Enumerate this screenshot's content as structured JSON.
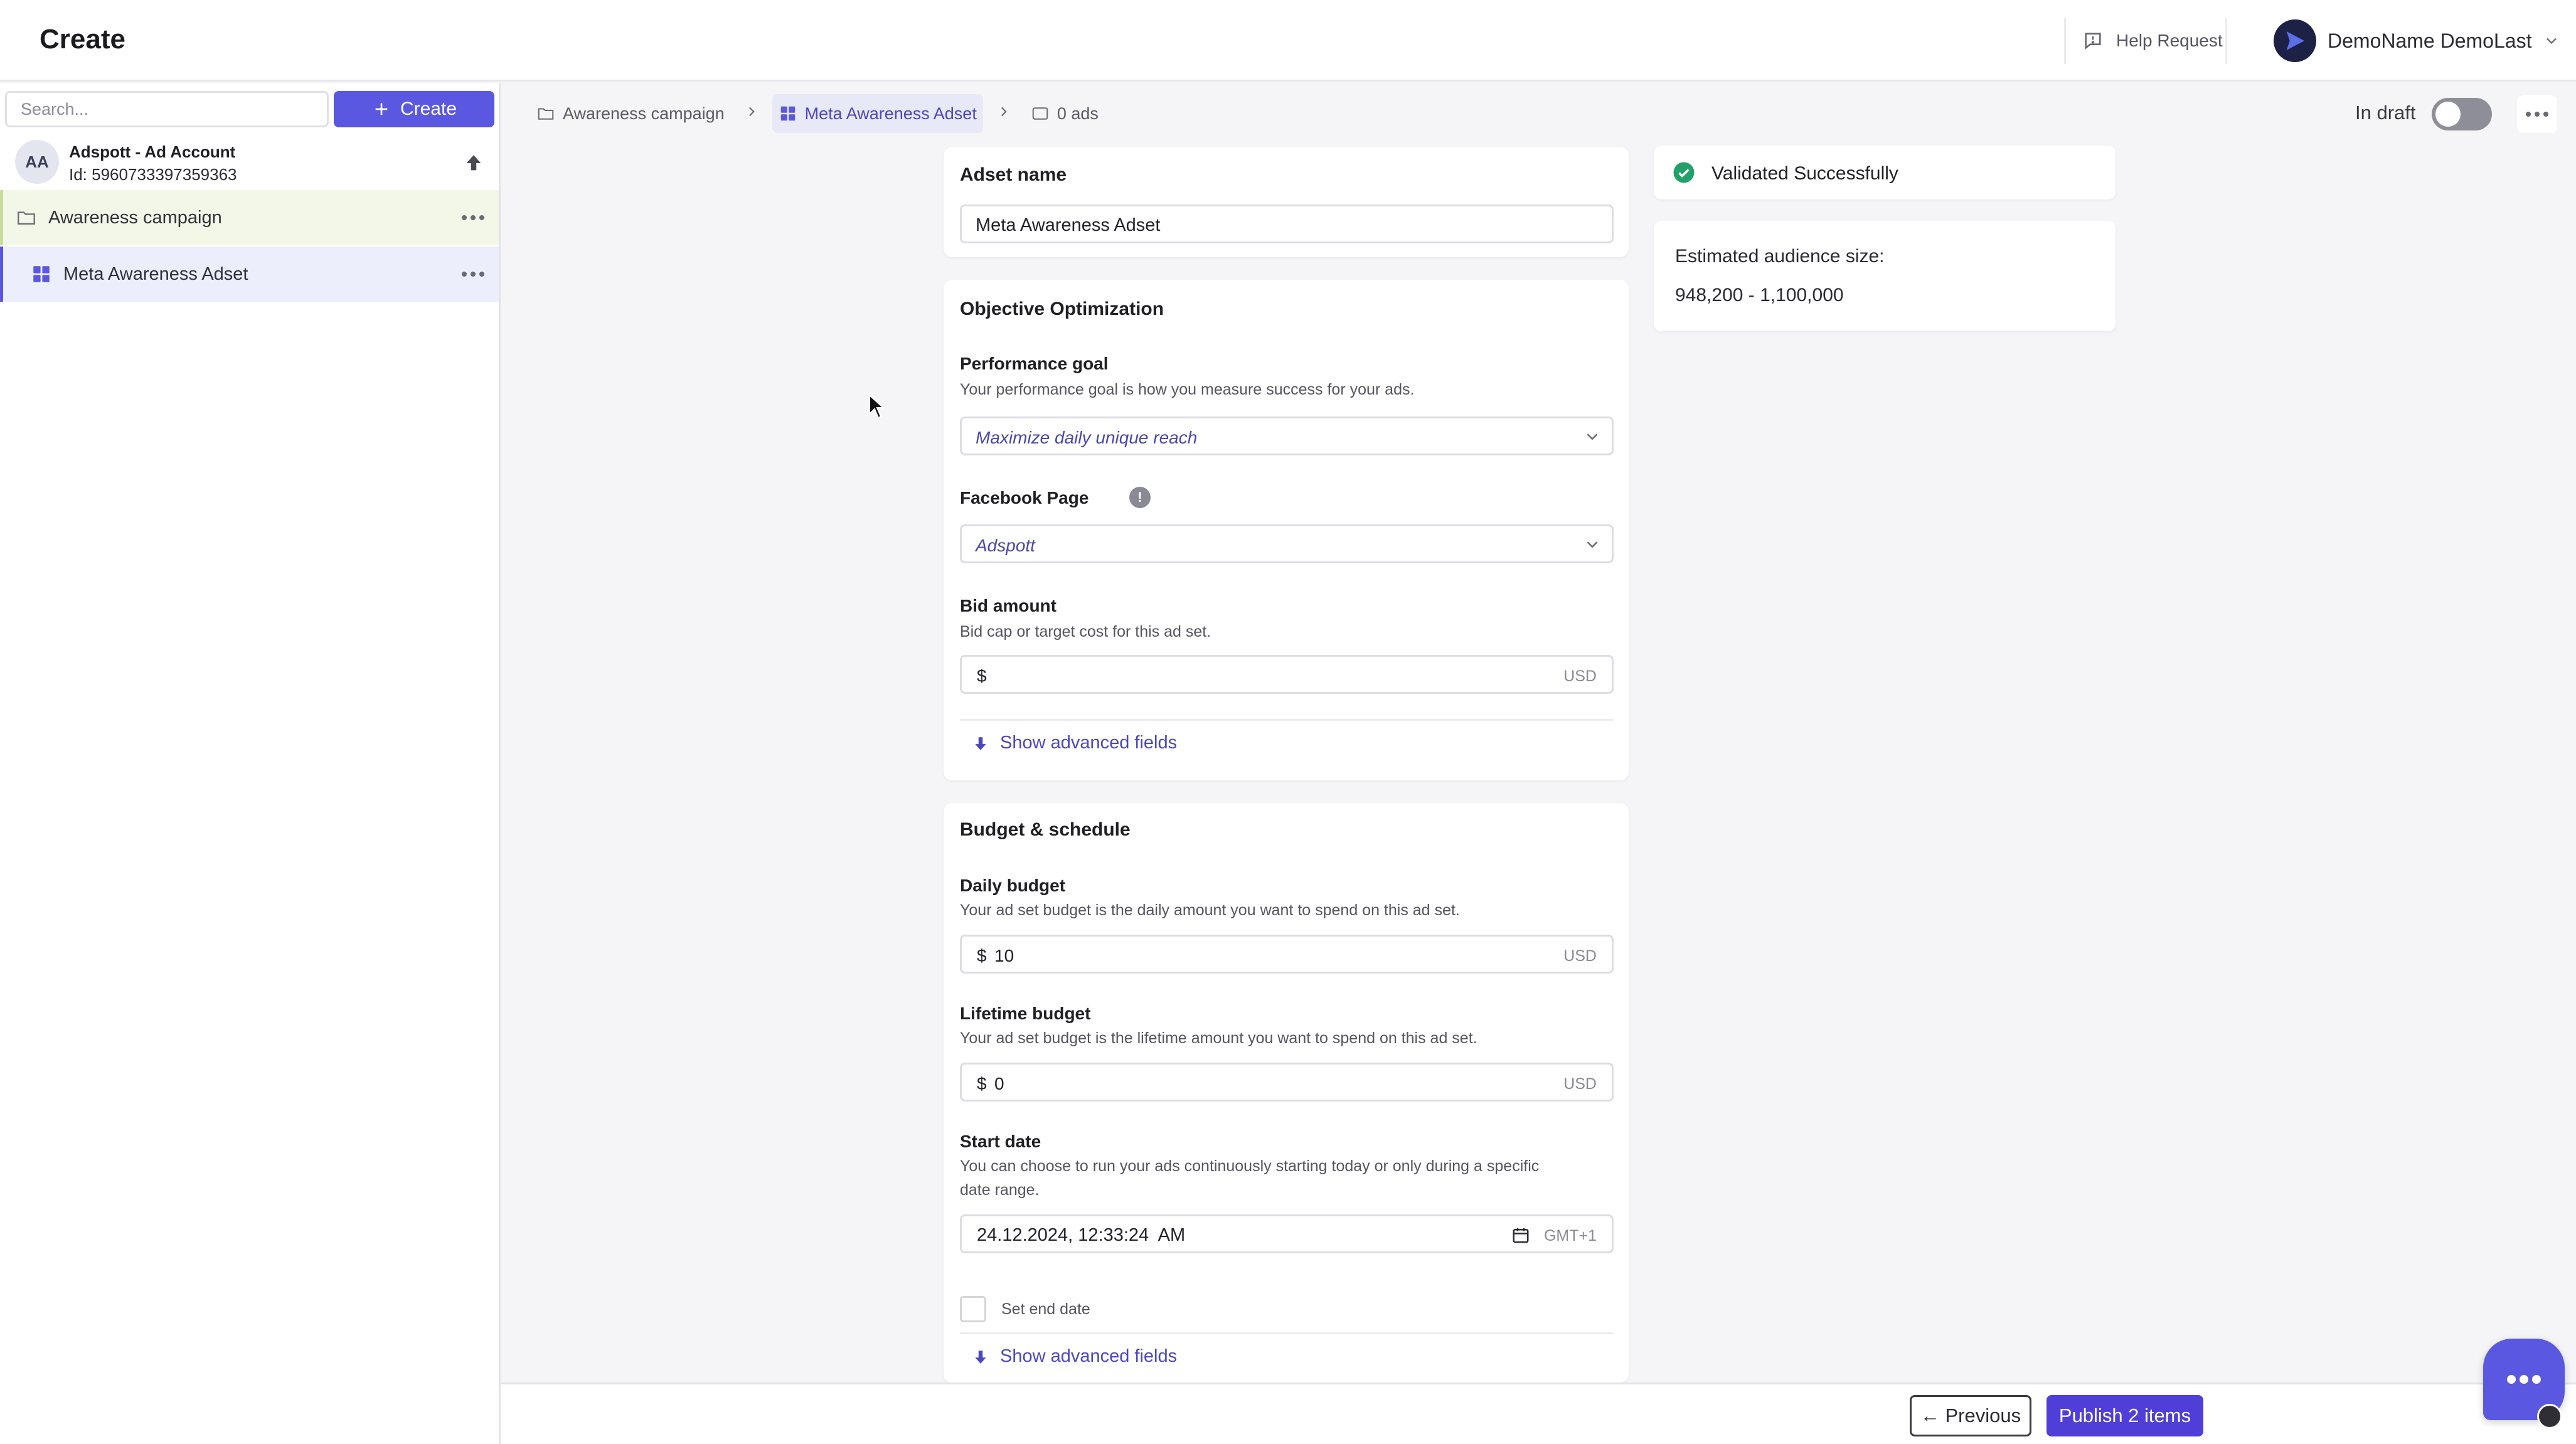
{
  "header": {
    "title": "Create",
    "help_request": "Help Request",
    "user_name": "DemoName DemoLast"
  },
  "sidebar": {
    "search_placeholder": "Search...",
    "create_label": "Create",
    "account": {
      "initials": "AA",
      "name": "Adspott - Ad Account",
      "id": "Id: 5960733397359363"
    },
    "items": [
      {
        "label": "Awareness campaign",
        "icon": "folder-icon"
      },
      {
        "label": "Meta Awareness Adset",
        "icon": "grid-icon"
      }
    ]
  },
  "breadcrumb": {
    "campaign": "Awareness campaign",
    "adset": "Meta Awareness Adset",
    "ads": "0 ads"
  },
  "status": {
    "draft_label": "In draft",
    "draft_on": false
  },
  "adset_card": {
    "title": "Adset name",
    "value": "Meta Awareness Adset"
  },
  "objective_card": {
    "title": "Objective Optimization",
    "performance_goal": {
      "label": "Performance goal",
      "help": "Your performance goal is how you measure success for your ads.",
      "value": "Maximize daily unique reach"
    },
    "facebook_page": {
      "label": "Facebook Page",
      "info": "!",
      "value": "Adspott"
    },
    "bid_amount": {
      "label": "Bid amount",
      "help": "Bid cap or target cost for this ad set.",
      "currency": "$",
      "value": "",
      "unit": "USD"
    },
    "advanced_label": "Show advanced fields"
  },
  "budget_card": {
    "title": "Budget & schedule",
    "daily_budget": {
      "label": "Daily budget",
      "help": "Your ad set budget is the daily amount you want to spend on this ad set.",
      "currency": "$",
      "value": "10",
      "unit": "USD"
    },
    "lifetime_budget": {
      "label": "Lifetime budget",
      "help": "Your ad set budget is the lifetime amount you want to spend on this ad set.",
      "currency": "$",
      "value": "0",
      "unit": "USD"
    },
    "start_date": {
      "label": "Start date",
      "help_line1": "You can choose to run your ads continuously starting today or only during a specific",
      "help_line2": "date range.",
      "value": "24.12.2024, 12:33:24  AM",
      "timezone": "GMT+1"
    },
    "end_date_label": "Set end date",
    "advanced_label": "Show advanced fields"
  },
  "validation": {
    "text": "Validated Successfully",
    "color": "#22a06b"
  },
  "audience": {
    "label": "Estimated audience size:",
    "range": "948,200 - 1,100,000"
  },
  "footer": {
    "previous_label": "← Previous",
    "publish_label": "Publish 2 items"
  },
  "colors": {
    "accent": "#5a57e0",
    "publish": "#4f3fd8",
    "campaign_bg": "#f2f7e8",
    "adset_bg": "#eceefb"
  }
}
